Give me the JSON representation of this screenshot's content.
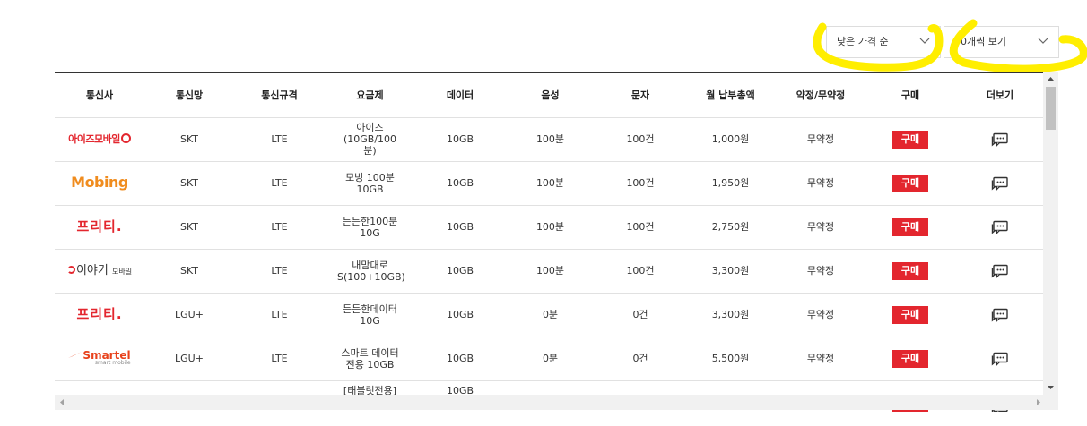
{
  "filters": {
    "sort": {
      "selected": "낮은 가격 순"
    },
    "page_size": {
      "selected": "50개씩 보기"
    }
  },
  "colors": {
    "buy_button": "#e3262e",
    "highlight": "#ffee00"
  },
  "table": {
    "headers": [
      "통신사",
      "통신망",
      "통신규격",
      "요금제",
      "데이터",
      "음성",
      "문자",
      "월 납부총액",
      "약정/무약정",
      "구매",
      "더보기"
    ],
    "rows": [
      {
        "carrier_logo": "아이즈모바일",
        "logo_style": "ize",
        "network": "SKT",
        "standard": "LTE",
        "plan": "아이즈(10GB/100분)",
        "data": "10GB",
        "voice": "100분",
        "sms": "100건",
        "monthly_total": "1,000원",
        "contract": "무약정",
        "buy_label": "구매",
        "more_icon": "chat-bubble-icon"
      },
      {
        "carrier_logo": "Mobing",
        "logo_style": "mobing",
        "network": "SKT",
        "standard": "LTE",
        "plan": "모빙 100분10GB",
        "data": "10GB",
        "voice": "100분",
        "sms": "100건",
        "monthly_total": "1,950원",
        "contract": "무약정",
        "buy_label": "구매",
        "more_icon": "chat-bubble-icon"
      },
      {
        "carrier_logo": "프리티.",
        "logo_style": "freet",
        "network": "SKT",
        "standard": "LTE",
        "plan": "든든한100분10G",
        "data": "10GB",
        "voice": "100분",
        "sms": "100건",
        "monthly_total": "2,750원",
        "contract": "무약정",
        "buy_label": "구매",
        "more_icon": "chat-bubble-icon"
      },
      {
        "carrier_logo": "이야기",
        "logo_sub": "모바일",
        "logo_style": "iyagi",
        "network": "SKT",
        "standard": "LTE",
        "plan": "내맘대로 S(100+10GB)",
        "data": "10GB",
        "voice": "100분",
        "sms": "100건",
        "monthly_total": "3,300원",
        "contract": "무약정",
        "buy_label": "구매",
        "more_icon": "chat-bubble-icon"
      },
      {
        "carrier_logo": "프리티.",
        "logo_style": "freet",
        "network": "LGU+",
        "standard": "LTE",
        "plan": "든든한데이터10G",
        "data": "10GB",
        "voice": "0분",
        "sms": "0건",
        "monthly_total": "3,300원",
        "contract": "무약정",
        "buy_label": "구매",
        "more_icon": "chat-bubble-icon"
      },
      {
        "carrier_logo": "Smartel",
        "logo_sub": "smart mobile",
        "logo_style": "smartel",
        "network": "LGU+",
        "standard": "LTE",
        "plan": "스마트 데이터전용 10GB",
        "data": "10GB",
        "voice": "0분",
        "sms": "0건",
        "monthly_total": "5,500원",
        "contract": "무약정",
        "buy_label": "구매",
        "more_icon": "chat-bubble-icon"
      },
      {
        "carrier_logo": "",
        "logo_style": "partial",
        "network": "",
        "standard": "",
        "plan": "[태블릿전용] LTE 스마",
        "data": "10GB",
        "voice": "",
        "sms": "",
        "monthly_total": "",
        "contract": "",
        "buy_label": "",
        "more_icon": "chat-bubble-icon"
      }
    ]
  }
}
